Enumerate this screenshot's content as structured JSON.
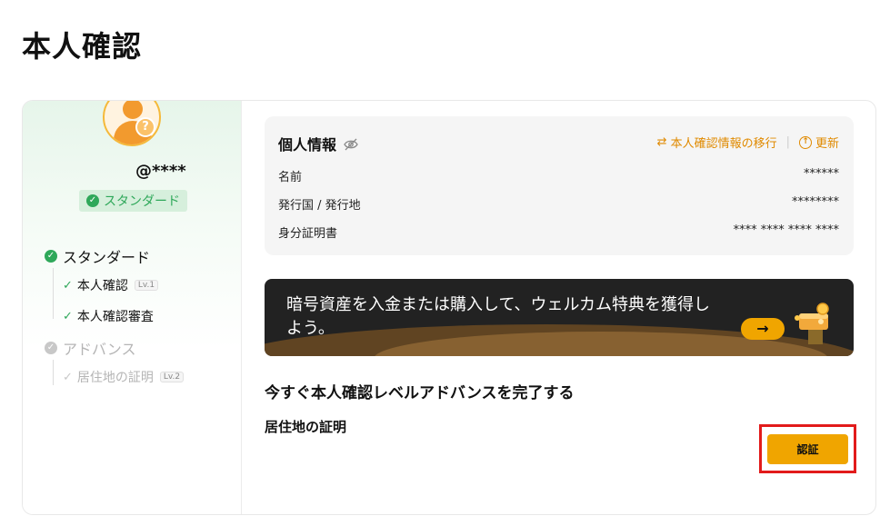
{
  "page": {
    "title": "本人確認"
  },
  "profile": {
    "username": "@****",
    "badge": "スタンダード"
  },
  "levels": {
    "standard": {
      "label": "スタンダード",
      "steps": [
        {
          "label": "本人確認",
          "tag": "Lv.1"
        },
        {
          "label": "本人確認審査",
          "tag": ""
        }
      ]
    },
    "advance": {
      "label": "アドバンス",
      "steps": [
        {
          "label": "居住地の証明",
          "tag": "Lv.2"
        }
      ]
    }
  },
  "personal_info": {
    "title": "個人情報",
    "migrate_label": "本人確認情報の移行",
    "refresh_label": "更新",
    "separator": "|",
    "rows": [
      {
        "label": "名前",
        "value": "******"
      },
      {
        "label": "発行国 / 発行地",
        "value": "********"
      },
      {
        "label": "身分証明書",
        "value": "**** **** **** ****"
      }
    ]
  },
  "banner": {
    "text": "暗号資産を入金または購入して、ウェルカム特典を獲得しよう。",
    "arrow": "→"
  },
  "complete": {
    "heading": "今すぐ本人確認レベルアドバンスを完了する",
    "item": "居住地の証明",
    "button": "認証"
  },
  "colors": {
    "accent": "#f0a500",
    "success": "#2fa85a",
    "highlight": "#e21b1b"
  }
}
